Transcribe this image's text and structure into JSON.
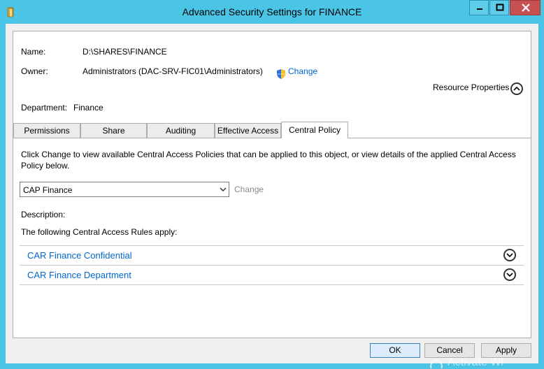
{
  "window": {
    "title": "Advanced Security Settings for FINANCE",
    "icon": "folder-icon"
  },
  "header": {
    "name_label": "Name:",
    "name_value": "D:\\SHARES\\FINANCE",
    "owner_label": "Owner:",
    "owner_value": "Administrators (DAC-SRV-FIC01\\Administrators)",
    "owner_change": "Change",
    "resource_properties": "Resource Properties",
    "department_label": "Department:",
    "department_value": "Finance"
  },
  "tabs": [
    {
      "label": "Permissions",
      "active": false
    },
    {
      "label": "Share",
      "active": false
    },
    {
      "label": "Auditing",
      "active": false
    },
    {
      "label": "Effective Access",
      "active": false
    },
    {
      "label": "Central Policy",
      "active": true
    }
  ],
  "central_policy": {
    "instructions": "Click Change to view available Central Access Policies that can be applied to this object, or view details of the applied Central Access Policy below.",
    "selected_policy": "CAP Finance",
    "change_label": "Change",
    "description_label": "Description:",
    "rules_heading": "The following Central Access Rules apply:",
    "rules": [
      {
        "label": "CAR Finance Confidential"
      },
      {
        "label": "CAR Finance Department"
      }
    ]
  },
  "buttons": {
    "ok": "OK",
    "cancel": "Cancel",
    "apply": "Apply"
  },
  "watermark": "Activate Wi",
  "colors": {
    "titlebar": "#4ac5e6",
    "link": "#0066cc",
    "close": "#c75050"
  }
}
